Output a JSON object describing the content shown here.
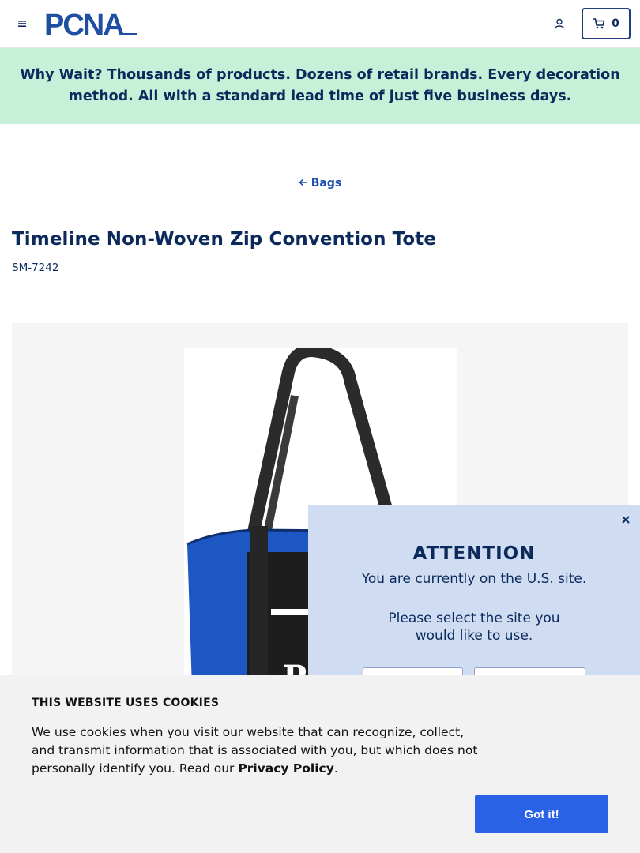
{
  "header": {
    "menu_icon": "hamburger-icon",
    "logo_text": "PCNA",
    "account_icon": "user-icon",
    "cart_icon": "cart-icon",
    "cart_count": "0"
  },
  "banner": {
    "text": "Why Wait? Thousands of products. Dozens of retail brands. Every decoration method. All with a standard lead time of just five business days."
  },
  "breadcrumb": {
    "back_label": "Bags",
    "arrow_icon": "arrow-left-icon"
  },
  "product": {
    "title": "Timeline Non-Woven Zip Convention Tote",
    "sku": "SM-7242",
    "image_letter": "P"
  },
  "attention_modal": {
    "close_icon": "close-icon",
    "heading": "ATTENTION",
    "current_site": "You are currently on the U.S. site.",
    "prompt": "Please select the site you would like to use."
  },
  "cookie_banner": {
    "heading": "THIS WEBSITE USES COOKIES",
    "body": "We use cookies when you visit our website that can recognize, collect, and transmit information that is associated with you, but which does not personally identify you. Read our ",
    "link_label": "Privacy Policy",
    "suffix": ".",
    "button_label": "Got it!"
  },
  "colors": {
    "navy": "#0b2a5b",
    "banner_bg": "#c8efd8",
    "modal_bg": "#cfdcf2",
    "button_blue": "#2a62e6",
    "bag_blue": "#1c57c4"
  }
}
